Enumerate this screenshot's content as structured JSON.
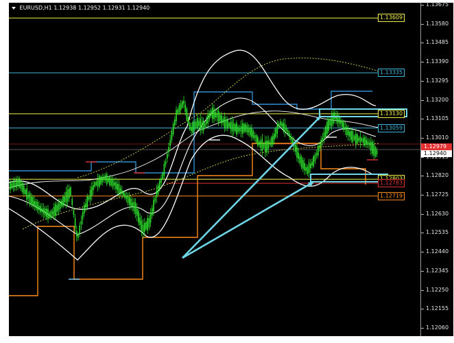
{
  "chart": {
    "symbol": "EURUSD,H1",
    "ohlc": "1.12938 1.12952 1.12931 1.12940",
    "y_range": [
      1.2015,
      1.13695
    ]
  },
  "scale": {
    "ticks": [
      "1.13675",
      "1.13580",
      "1.13485",
      "1.13390",
      "1.13295",
      "1.13200",
      "1.13105",
      "1.13010",
      "1.12915",
      "1.12820",
      "1.12725",
      "1.12630",
      "1.12535",
      "1.12440",
      "1.12345",
      "1.12250",
      "1.12155",
      "1.12060"
    ]
  },
  "levels": [
    {
      "label": "1.13609",
      "price": 1.13609,
      "color": "#f4f24a"
    },
    {
      "label": "1.13335",
      "price": 1.13335,
      "color": "#3fb3d8"
    },
    {
      "label": "1.13130",
      "price": 1.1313,
      "color": "#f4f24a"
    },
    {
      "label": "1.13059",
      "price": 1.13059,
      "color": "#3fb3d8"
    },
    {
      "label": "1.12803",
      "price": 1.12803,
      "color": "#f4f24a"
    },
    {
      "label": "1.12783",
      "price": 1.12783,
      "color": "#e23030"
    },
    {
      "label": "1.12719",
      "price": 1.12719,
      "color": "#ff8c1a"
    }
  ],
  "price_tags": {
    "current": {
      "label": "1.12940",
      "color": "#ffffff"
    },
    "bid": {
      "label": "1.12979",
      "color": "#e23030"
    }
  },
  "colors": {
    "candle": "#2ee82e",
    "band": "#ffffff",
    "orange": "#ff8c1a",
    "blue": "#2f8fd1",
    "yellow": "#f4f24a",
    "arrow": "#6fd6e8"
  }
}
